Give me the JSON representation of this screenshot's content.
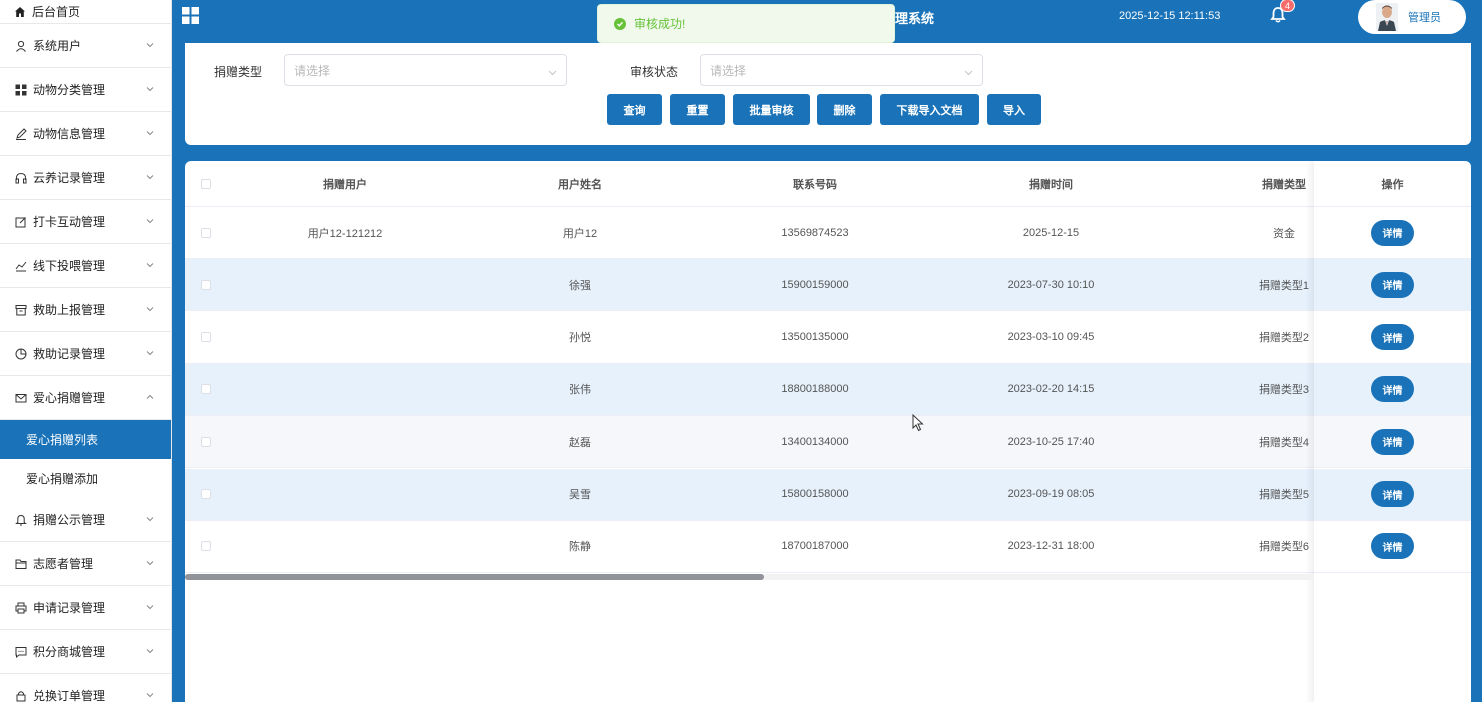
{
  "sidebar": {
    "home_label": "后台首页",
    "items": [
      {
        "label": "系统用户",
        "icon": "user-icon"
      },
      {
        "label": "动物分类管理",
        "icon": "grid-icon"
      },
      {
        "label": "动物信息管理",
        "icon": "pen-icon"
      },
      {
        "label": "云养记录管理",
        "icon": "headphones-icon"
      },
      {
        "label": "打卡互动管理",
        "icon": "edit-icon"
      },
      {
        "label": "线下投喂管理",
        "icon": "chart-icon"
      },
      {
        "label": "救助上报管理",
        "icon": "box-icon"
      },
      {
        "label": "救助记录管理",
        "icon": "pie-icon"
      },
      {
        "label": "爱心捐赠管理",
        "icon": "mail-icon"
      }
    ],
    "sub_items": [
      {
        "label": "爱心捐赠列表",
        "active": true
      },
      {
        "label": "爱心捐赠添加",
        "active": false
      }
    ],
    "items_after": [
      {
        "label": "捐赠公示管理",
        "icon": "bell-icon"
      },
      {
        "label": "志愿者管理",
        "icon": "folder-icon"
      },
      {
        "label": "申请记录管理",
        "icon": "printer-icon"
      },
      {
        "label": "积分商城管理",
        "icon": "chat-icon"
      },
      {
        "label": "兑换订单管理",
        "icon": "lock-icon"
      }
    ]
  },
  "header": {
    "toast_message": "审核成功!",
    "title_fragment": "理系统",
    "datetime": "2025-12-15 12:11:53",
    "notification_count": "4",
    "user_name": "管理员"
  },
  "search": {
    "donation_type_label": "捐赠类型",
    "donation_type_placeholder": "请选择",
    "audit_status_label": "审核状态",
    "audit_status_placeholder": "请选择",
    "buttons": {
      "query": "查询",
      "reset": "重置",
      "batch_audit": "批量审核",
      "delete": "删除",
      "download_template": "下载导入文档",
      "import": "导入"
    }
  },
  "table": {
    "columns": [
      "捐赠用户",
      "用户姓名",
      "联系号码",
      "捐赠时间",
      "捐赠类型",
      "操作"
    ],
    "detail_label": "详情",
    "rows": [
      {
        "user": "用户12-121212",
        "name": "用户12",
        "phone": "13569874523",
        "time": "2025-12-15",
        "type": "资金"
      },
      {
        "user": "",
        "name": "徐强",
        "phone": "15900159000",
        "time": "2023-07-30 10:10",
        "type": "捐赠类型1"
      },
      {
        "user": "",
        "name": "孙悦",
        "phone": "13500135000",
        "time": "2023-03-10 09:45",
        "type": "捐赠类型2"
      },
      {
        "user": "",
        "name": "张伟",
        "phone": "18800188000",
        "time": "2023-02-20 14:15",
        "type": "捐赠类型3"
      },
      {
        "user": "",
        "name": "赵磊",
        "phone": "13400134000",
        "time": "2023-10-25 17:40",
        "type": "捐赠类型4"
      },
      {
        "user": "",
        "name": "吴雪",
        "phone": "15800158000",
        "time": "2023-09-19 08:05",
        "type": "捐赠类型5"
      },
      {
        "user": "",
        "name": "陈静",
        "phone": "18700187000",
        "time": "2023-12-31 18:00",
        "type": "捐赠类型6"
      }
    ]
  },
  "colors": {
    "primary": "#1a73b8",
    "row_alt": "#e6f1fc",
    "toast_green": "#67c23a",
    "badge_red": "#f56c6c"
  }
}
